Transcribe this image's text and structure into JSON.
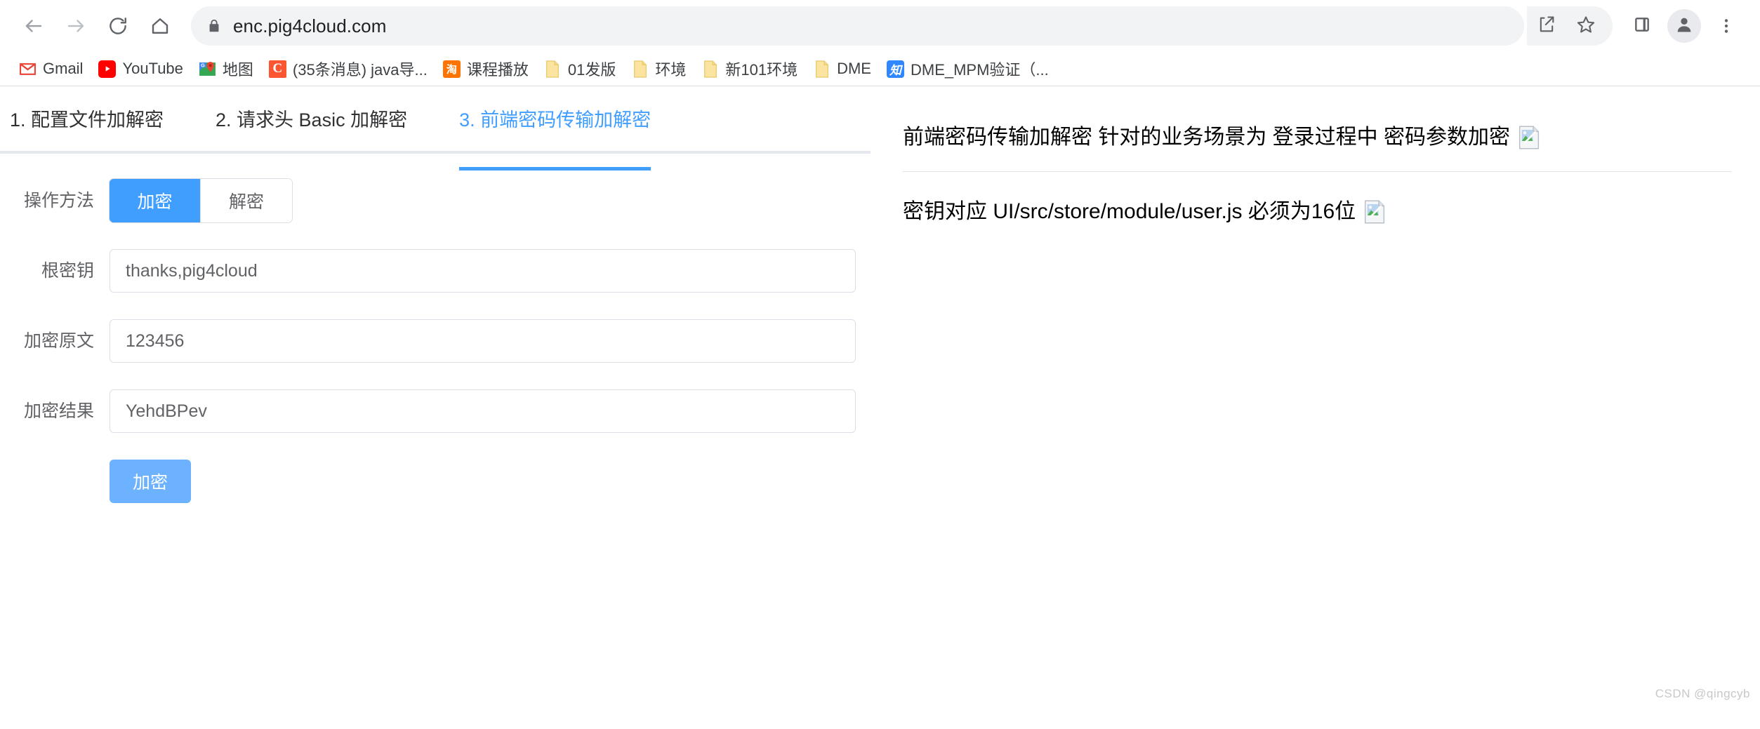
{
  "browser": {
    "url": "enc.pig4cloud.com",
    "nav": {
      "back": "back-arrow",
      "forward": "forward-arrow",
      "reload": "reload",
      "home": "home"
    },
    "omnibox_actions": {
      "share": "share",
      "bookmark": "star"
    },
    "trailing": {
      "side_panel": "side-panel",
      "profile": "profile-avatar",
      "menu": "three-dot-menu"
    },
    "bookmarks": [
      {
        "label": "Gmail",
        "icon": "gmail-icon",
        "glyph": "M"
      },
      {
        "label": "YouTube",
        "icon": "youtube-icon",
        "glyph": "▶"
      },
      {
        "label": "地图",
        "icon": "maps-icon",
        "glyph": "G"
      },
      {
        "label": "(35条消息) java导...",
        "icon": "csdn-icon",
        "glyph": "C"
      },
      {
        "label": "课程播放",
        "icon": "taobao-icon",
        "glyph": "淘"
      },
      {
        "label": "01发版",
        "icon": "folder-icon",
        "glyph": ""
      },
      {
        "label": "环境",
        "icon": "folder-icon",
        "glyph": ""
      },
      {
        "label": "新101环境",
        "icon": "folder-icon",
        "glyph": ""
      },
      {
        "label": "DME",
        "icon": "folder-icon",
        "glyph": ""
      },
      {
        "label": "DME_MPM验证（...",
        "icon": "zhihu-icon",
        "glyph": "知"
      }
    ]
  },
  "main": {
    "tabs": [
      {
        "label": "1. 配置文件加解密",
        "active": false
      },
      {
        "label": "2. 请求头 Basic 加解密",
        "active": false
      },
      {
        "label": "3. 前端密码传输加解密",
        "active": true
      }
    ],
    "form": {
      "method": {
        "label": "操作方法",
        "options": [
          {
            "label": "加密",
            "active": true
          },
          {
            "label": "解密",
            "active": false
          }
        ]
      },
      "root_key": {
        "label": "根密钥",
        "value": "thanks,pig4cloud",
        "placeholder": ""
      },
      "plaintext": {
        "label": "加密原文",
        "value": "123456",
        "placeholder": ""
      },
      "result": {
        "label": "加密结果",
        "value": "YehdBPev",
        "placeholder": ""
      },
      "submit_label": "加密"
    },
    "notes": [
      {
        "text": "前端密码传输加解密 针对的业务场景为 登录过程中 密码参数加密",
        "icon": "broken-image-icon"
      },
      {
        "text": "密钥对应 UI/src/store/module/user.js 必须为16位",
        "icon": "broken-image-icon"
      }
    ],
    "watermark": "CSDN @qingcyb"
  },
  "colors": {
    "accent": "#409eff",
    "button": "#6cb2ff",
    "border": "#dcdfe6",
    "text": "#606266"
  }
}
